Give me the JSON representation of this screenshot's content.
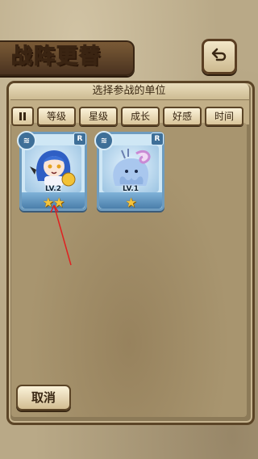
{
  "screen": {
    "title": "战阵更替",
    "subtitle": "选择参战的单位"
  },
  "toolbar": {
    "filter_toggle_icon": "pause-bars-icon",
    "buttons": [
      "等级",
      "星级",
      "成长",
      "好感",
      "时间"
    ]
  },
  "units": [
    {
      "level": "LV.2",
      "stars": "★★",
      "star_count": 2,
      "rank": "R",
      "element_icon": "wave-icon",
      "portrait": "blue-haired-girl-with-bell"
    },
    {
      "level": "LV.1",
      "stars": "★",
      "star_count": 1,
      "rank": "R",
      "element_icon": "wave-icon",
      "portrait": "blue-jelly-creature-with-shell"
    }
  ],
  "footer": {
    "cancel_label": "取消"
  },
  "colors": {
    "accent_card_border": "#6e9cbf",
    "star": "#f6c43c",
    "annotation_arrow": "#e02020"
  }
}
